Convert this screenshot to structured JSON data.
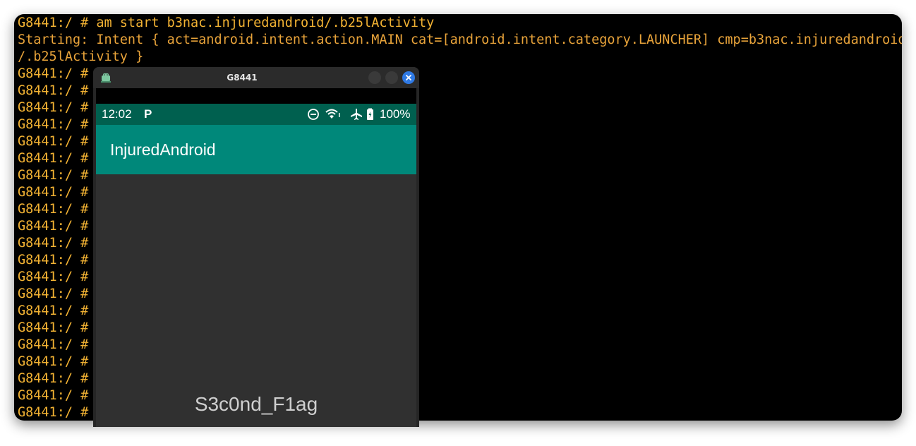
{
  "terminal": {
    "lines": [
      "G8441:/ # am start b3nac.injuredandroid/.b25lActivity",
      "Starting: Intent { act=android.intent.action.MAIN cat=[android.intent.category.LAUNCHER] cmp=b3nac.injuredandroid",
      "/.b25lActivity }"
    ],
    "prompt": "G8441:/ #"
  },
  "scrcpy": {
    "window_title": "G8441",
    "statusbar": {
      "time": "12:02",
      "notification": "P",
      "battery": "100%"
    },
    "app_title": "InjuredAndroid",
    "flag_text": "S3c0nd_F1ag"
  },
  "colors": {
    "terminal_text": "#e8a33a",
    "statusbar": "#00604f",
    "appbar": "#00887a",
    "content_bg": "#303030",
    "close_button": "#2f7ae5"
  }
}
